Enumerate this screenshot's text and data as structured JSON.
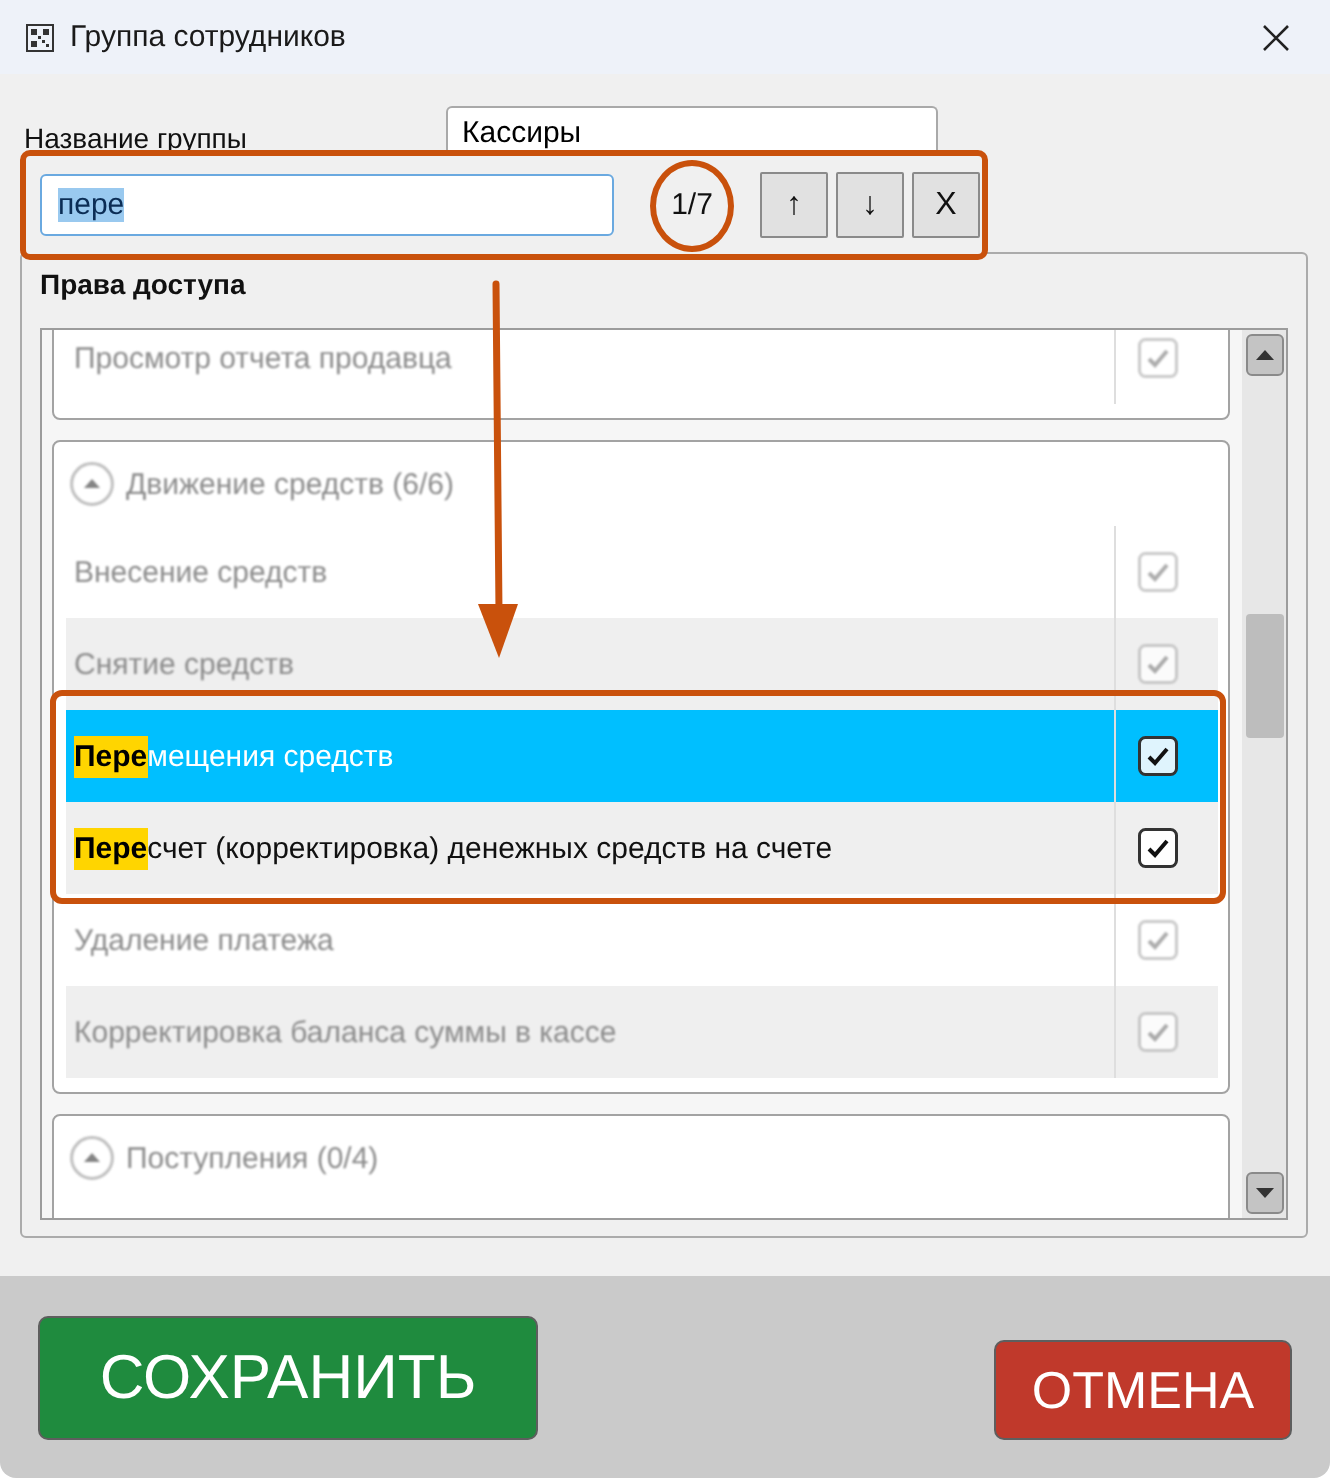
{
  "window": {
    "title": "Группа сотрудников"
  },
  "group_name": {
    "label": "Название группы",
    "value": "Кассиры"
  },
  "search": {
    "value": "пере",
    "value_selected": true,
    "match_counter": "1/7",
    "buttons": [
      "↑",
      "↓",
      "X"
    ]
  },
  "permissions": {
    "title": "Права доступа",
    "groups": [
      {
        "items": [
          {
            "label": "Просмотр отчета продавца",
            "checked": true,
            "selected": false,
            "dimmed": true
          }
        ]
      },
      {
        "title": "Движение средств (6/6)",
        "expanded": true,
        "dimmed": true,
        "items": [
          {
            "label": "Внесение средств",
            "checked": true,
            "selected": false,
            "dimmed": true
          },
          {
            "label": "Снятие средств",
            "checked": true,
            "selected": false,
            "dimmed": true
          },
          {
            "label": "**Пере**мещения средств",
            "checked": true,
            "selected": true,
            "dimmed": false
          },
          {
            "label": "**Пере**счет (корректировка) денежных средств на счете",
            "checked": true,
            "selected": false,
            "dimmed": false
          },
          {
            "label": "Удаление платежа",
            "checked": true,
            "selected": false,
            "dimmed": true
          },
          {
            "label": "Корректировка баланса суммы в кассе",
            "checked": true,
            "selected": false,
            "dimmed": true
          }
        ]
      },
      {
        "title": "Поступления (0/4)",
        "expanded": true,
        "dimmed": true
      }
    ]
  },
  "buttons": [
    {
      "kind": "save",
      "label": "СОХРАНИТЬ"
    },
    {
      "kind": "cancel",
      "label": "ОТМЕНА"
    }
  ]
}
